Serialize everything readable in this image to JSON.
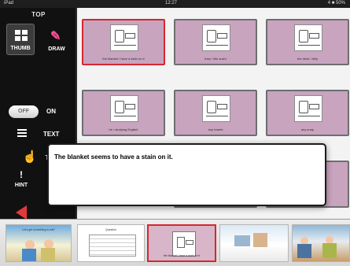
{
  "status_bar": {
    "carrier": "iPad",
    "time": "12:27",
    "battery": "4 ■ 50%"
  },
  "sidebar": {
    "section_title": "TOP",
    "thumb_label": "THUMB",
    "draw_label": "DRAW",
    "toggle_off": "OFF",
    "toggle_on": "ON",
    "text_label": "TEXT",
    "t_label": "T",
    "hint_label": "HINT",
    "pencil_icon": "pencil-icon",
    "grid_icon": "grid-icon",
    "list_icon": "list-icon",
    "hand_icon": "hand-pointer-icon",
    "hint_icon": "exclamation-icon",
    "back_icon": "left-arrow-icon"
  },
  "cards": [
    {
      "caption": "the blanket / have a stain on it",
      "selected": true
    },
    {
      "caption": "they / like sushi"
    },
    {
      "caption": "the desk / dirty"
    },
    {
      "caption": "he / studying English"
    },
    {
      "caption": "any towels"
    },
    {
      "caption": "any soap"
    }
  ],
  "popup": {
    "message": "The blanket seems to have a stain on it."
  },
  "filmstrip": {
    "items": [
      {
        "caption": "Let's get something to eat?"
      },
      {
        "caption": "Question"
      },
      {
        "caption": "the blanket / have a stain on it",
        "selected": true
      },
      {
        "caption": ""
      },
      {
        "caption": ""
      }
    ]
  },
  "colors": {
    "accent_red": "#d72630",
    "card_pink": "#c8a4bf",
    "sidebar_bg": "#111111",
    "hand_orange": "#f0a61f"
  }
}
